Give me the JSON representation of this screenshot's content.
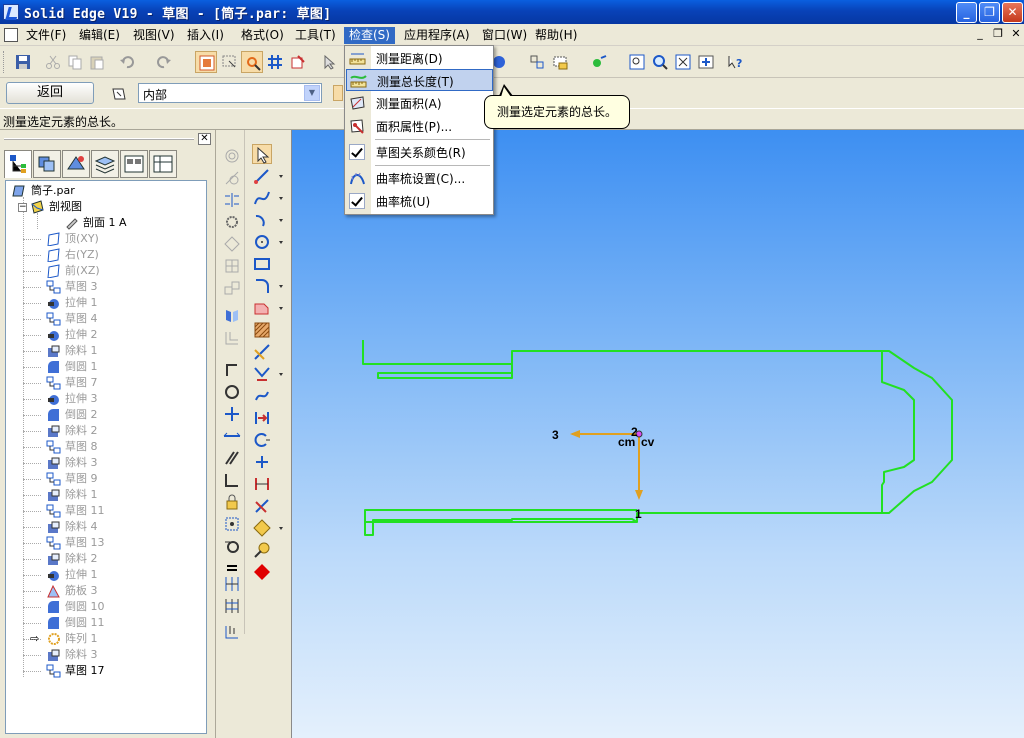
{
  "window": {
    "title": "Solid Edge V19 - 草图 - [筒子.par: 草图]",
    "buttons": [
      "minimize",
      "restore",
      "close"
    ]
  },
  "menubar": {
    "items": [
      {
        "label": "文件(F)"
      },
      {
        "label": "编辑(E)"
      },
      {
        "label": "视图(V)"
      },
      {
        "label": "插入(I)"
      },
      {
        "label": "格式(O)"
      },
      {
        "label": "工具(T)"
      },
      {
        "label": "检查(S)",
        "active": true
      },
      {
        "label": "应用程序(A)"
      },
      {
        "label": "窗口(W)"
      },
      {
        "label": "帮助(H)"
      }
    ]
  },
  "inspect_menu": {
    "items": [
      {
        "label": "测量距离(D)",
        "icon": "measure-distance-icon"
      },
      {
        "label": "测量总长度(T)",
        "icon": "measure-total-length-icon",
        "highlighted": true
      },
      {
        "label": "测量面积(A)",
        "icon": "measure-area-icon"
      },
      {
        "label": "面积属性(P)...",
        "icon": "area-properties-icon"
      },
      {
        "label": "草图关系颜色(R)",
        "checked": true
      },
      {
        "label": "曲率梳设置(C)...",
        "icon": "curvature-comb-settings-icon"
      },
      {
        "label": "曲率梳(U)",
        "checked": true
      }
    ]
  },
  "tooltip": {
    "text": "测量选定元素的总长。"
  },
  "ribbon": {
    "back_label": "返回",
    "combo_value": "内部"
  },
  "prompt": {
    "text": "测量选定元素的总长。"
  },
  "pathfinder": {
    "root": "筒子.par",
    "section_view": "剖视图",
    "section": "剖面 1 A",
    "features": [
      {
        "label": "顶(XY)",
        "icon": "plane-icon"
      },
      {
        "label": "右(YZ)",
        "icon": "plane-icon"
      },
      {
        "label": "前(XZ)",
        "icon": "plane-icon"
      },
      {
        "label": "草图 3",
        "icon": "sketch-icon"
      },
      {
        "label": "拉伸 1",
        "icon": "protrusion-icon"
      },
      {
        "label": "草图 4",
        "icon": "sketch-icon"
      },
      {
        "label": "拉伸 2",
        "icon": "protrusion-icon"
      },
      {
        "label": "除料 1",
        "icon": "cutout-icon"
      },
      {
        "label": "倒圆 1",
        "icon": "round-icon"
      },
      {
        "label": "草图 7",
        "icon": "sketch-icon"
      },
      {
        "label": "拉伸 3",
        "icon": "protrusion-icon"
      },
      {
        "label": "倒圆 2",
        "icon": "round-icon"
      },
      {
        "label": "除料 2",
        "icon": "cutout-icon"
      },
      {
        "label": "草图 8",
        "icon": "sketch-icon"
      },
      {
        "label": "除料 3",
        "icon": "cutout-icon"
      },
      {
        "label": "草图 9",
        "icon": "sketch-icon"
      },
      {
        "label": "除料 1",
        "icon": "cutout-icon"
      },
      {
        "label": "草图 11",
        "icon": "sketch-icon"
      },
      {
        "label": "除料 4",
        "icon": "cutout-icon"
      },
      {
        "label": "草图 13",
        "icon": "sketch-icon"
      },
      {
        "label": "除料 2",
        "icon": "cutout-icon"
      },
      {
        "label": "拉伸 1",
        "icon": "protrusion-icon"
      },
      {
        "label": "筋板 3",
        "icon": "rib-icon"
      },
      {
        "label": "倒圆 10",
        "icon": "round-icon"
      },
      {
        "label": "倒圆 11",
        "icon": "round-icon"
      },
      {
        "label": "阵列 1",
        "icon": "pattern-icon"
      },
      {
        "label": "除料 3",
        "icon": "cutout-icon"
      },
      {
        "label": "草图 17",
        "icon": "sketch-icon",
        "active": true
      }
    ]
  },
  "canvas": {
    "labels": {
      "axis3": "3",
      "axis2": "2",
      "axis1": "1",
      "cm": "cm",
      "cv": "cv"
    },
    "profile_color": "#22E022",
    "axis_color": "#E0A020"
  }
}
